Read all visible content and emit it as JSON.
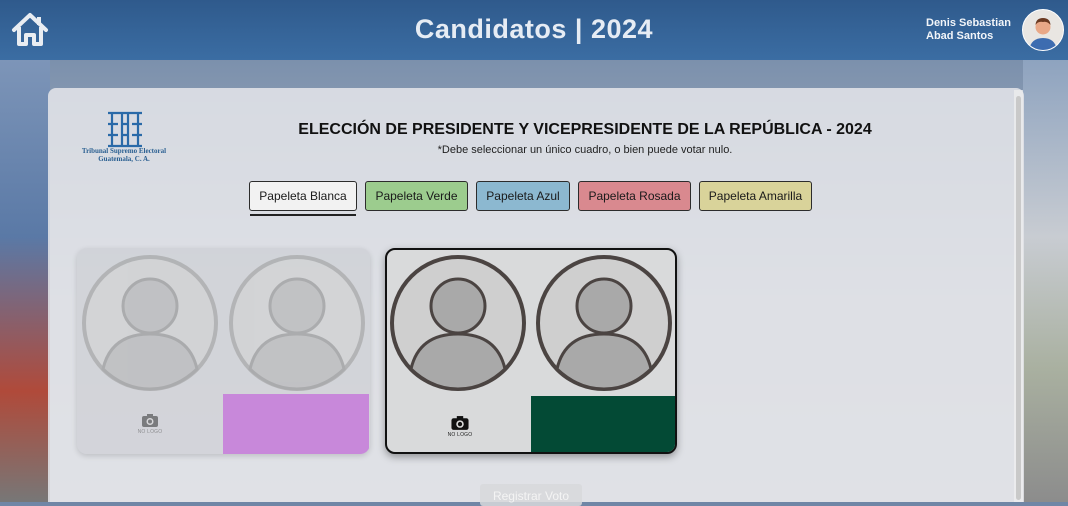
{
  "header": {
    "title": "Candidatos | 2024",
    "user_name": "Denis Sebastian Abad Santos",
    "home_icon": "home-icon"
  },
  "institution": {
    "line1": "Tribunal Supremo Electoral",
    "line2": "Guatemala, C. A."
  },
  "election": {
    "title": "ELECCIÓN DE PRESIDENTE Y VICEPRESIDENTE DE LA REPÚBLICA - 2024",
    "instruction": "*Debe seleccionar un único cuadro, o bien puede votar nulo."
  },
  "tabs": [
    {
      "label": "Papeleta Blanca",
      "color": "#f2f2f2",
      "active": true
    },
    {
      "label": "Papeleta Verde",
      "color": "#9ccc8e"
    },
    {
      "label": "Papeleta Azul",
      "color": "#8cb8d0"
    },
    {
      "label": "Papeleta Rosada",
      "color": "#d9898f"
    },
    {
      "label": "Papeleta Amarilla",
      "color": "#d9d39a"
    }
  ],
  "candidates": [
    {
      "logo_label": "NO LOGO",
      "party_color": "#c77fd9",
      "selected": false
    },
    {
      "logo_label": "NO LOGO",
      "party_color": "#034a35",
      "selected": true
    }
  ],
  "register_button": "Registrar Voto",
  "colors": {
    "header": "#3565 9a",
    "accent": "#2a5f91"
  }
}
